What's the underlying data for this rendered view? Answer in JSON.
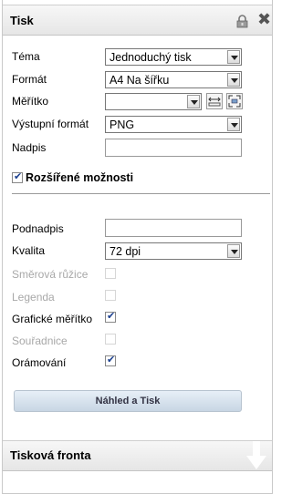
{
  "header": {
    "title": "Tisk",
    "lock_icon": "lock-icon",
    "close_icon": "close-icon",
    "close_glyph": "✖"
  },
  "fields": {
    "tema": {
      "label": "Téma",
      "value": "Jednoduchý tisk"
    },
    "format": {
      "label": "Formát",
      "value": "A4 Na šířku"
    },
    "meritko": {
      "label": "Měřítko",
      "value": ""
    },
    "vystupni_format": {
      "label": "Výstupní formát",
      "value": "PNG"
    },
    "nadpis": {
      "label": "Nadpis",
      "value": ""
    }
  },
  "advanced": {
    "label": "Rozšířené možnosti",
    "checked": true
  },
  "advanced_fields": {
    "podnadpis": {
      "label": "Podnadpis",
      "value": ""
    },
    "kvalita": {
      "label": "Kvalita",
      "value": "72 dpi"
    },
    "smerova_ruzice": {
      "label": "Směrová růžice",
      "checked": false,
      "disabled": true
    },
    "legenda": {
      "label": "Legenda",
      "checked": false,
      "disabled": true
    },
    "graficke_meritko": {
      "label": "Grafické měřítko",
      "checked": true,
      "disabled": false
    },
    "souradnice": {
      "label": "Souřadnice",
      "checked": false,
      "disabled": true
    },
    "oramovani": {
      "label": "Orámování",
      "checked": true,
      "disabled": false
    }
  },
  "preview_button": {
    "label": "Náhled a Tisk"
  },
  "footer": {
    "title": "Tisková fronta",
    "arrow_icon": "arrow-down-icon"
  }
}
